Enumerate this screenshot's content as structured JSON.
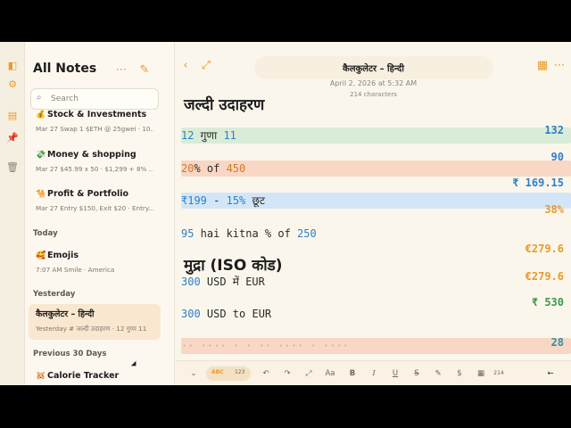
{
  "rail": {
    "icons": [
      "sidebar-toggle-icon",
      "gear-icon",
      "document-icon",
      "pin-icon",
      "trash-icon"
    ]
  },
  "sidebar": {
    "title": "All Notes",
    "search_placeholder": "Search",
    "notes": [
      {
        "emoji": "💰",
        "title": "Stock & Investments",
        "meta": "Mar 27  Swap 1 $ETH @ 25gwei · 10..."
      },
      {
        "emoji": "💸",
        "title": "Money & shopping",
        "meta": "Mar 27  $45.99 x 50 · $1,299 + 8% ..."
      },
      {
        "emoji": "🐪",
        "title": "Profit & Portfolio",
        "meta": "Mar 27  Entry $150, Exit $20 · Entry..."
      },
      {
        "emoji": "🥰",
        "title": "Emojis",
        "meta": "7:07 AM  Smile · America"
      },
      {
        "emoji": "",
        "title": "कैलकुलेटर – हिन्दी",
        "meta": "Yesterday  # जल्दी उदाहरण · 12 गुणा 11"
      },
      {
        "emoji": "🐹",
        "title": "Calorie Tracker",
        "meta": ""
      }
    ],
    "sections": [
      "Today",
      "Yesterday",
      "Previous 30 Days"
    ]
  },
  "editor": {
    "title": "कैलकुलेटर – हिन्दी",
    "date": "April 2, 2026 at 5:32 AM",
    "chars": "214 characters",
    "heading1": "जल्दी उदाहरण",
    "heading2": "मुद्रा (ISO कोड)",
    "lines": [
      {
        "a": "12",
        "b": " गुणा ",
        "c": "11"
      },
      {
        "a": "20",
        "b": "% of ",
        "c": "450"
      },
      {
        "a": "₹199",
        "b": " - ",
        "c": "15%",
        "d": " छूट"
      },
      {
        "a": "95",
        "b": " hai kitna % of ",
        "c": "250"
      },
      {
        "a": "300",
        "b": " USD में EUR"
      },
      {
        "a": "300",
        "b": " USD to EUR"
      }
    ],
    "results": [
      "132",
      "90",
      "₹ 169.15",
      "38%",
      "€279.6",
      "€279.6",
      "₹ 530",
      "28"
    ],
    "partial_line": "·· ···· · · ··  ···· ·  ····"
  },
  "toolbar": {
    "mode_a": "ABC",
    "mode_b": "123",
    "items": [
      "⌄",
      "↶",
      "↷",
      "⤢",
      "Aa",
      "B",
      "I",
      "U",
      "S",
      "✎",
      "$",
      "▦",
      "214",
      "←"
    ]
  }
}
